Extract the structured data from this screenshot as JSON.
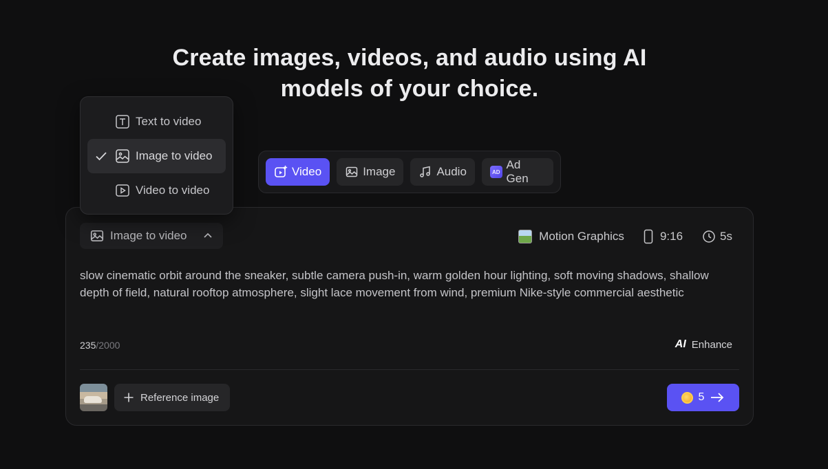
{
  "headline": {
    "line1": "Create images, videos, and audio using AI",
    "line2": "models of your choice."
  },
  "modes": [
    {
      "label": "Video",
      "icon": "video-sparkle-icon",
      "active": true
    },
    {
      "label": "Image",
      "icon": "image-icon",
      "active": false
    },
    {
      "label": "Audio",
      "icon": "music-note-icon",
      "active": false
    },
    {
      "label": "Ad Gen",
      "icon": "ad-badge-icon",
      "badge": "AD",
      "active": false
    }
  ],
  "dropdown": {
    "items": [
      {
        "label": "Text to video",
        "icon": "text-box-icon",
        "selected": false
      },
      {
        "label": "Image to video",
        "icon": "image-icon",
        "selected": true
      },
      {
        "label": "Video to video",
        "icon": "play-box-icon",
        "selected": false
      }
    ]
  },
  "card": {
    "type_select": "Image to video",
    "style": "Motion Graphics",
    "aspect": "9:16",
    "duration": "5s",
    "prompt": "slow cinematic orbit around the sneaker, subtle camera push-in, warm golden hour lighting, soft moving shadows, shallow depth of field, natural rooftop atmosphere, slight lace movement from wind, premium Nike-style commercial aesthetic",
    "char_count": "235",
    "char_max": "/2000",
    "enhance_badge": "AI",
    "enhance_label": "Enhance",
    "reference_label": "Reference image",
    "generate_cost": "5"
  },
  "colors": {
    "accent": "#5a52f3",
    "background": "#0f0f10",
    "card": "#161617"
  }
}
